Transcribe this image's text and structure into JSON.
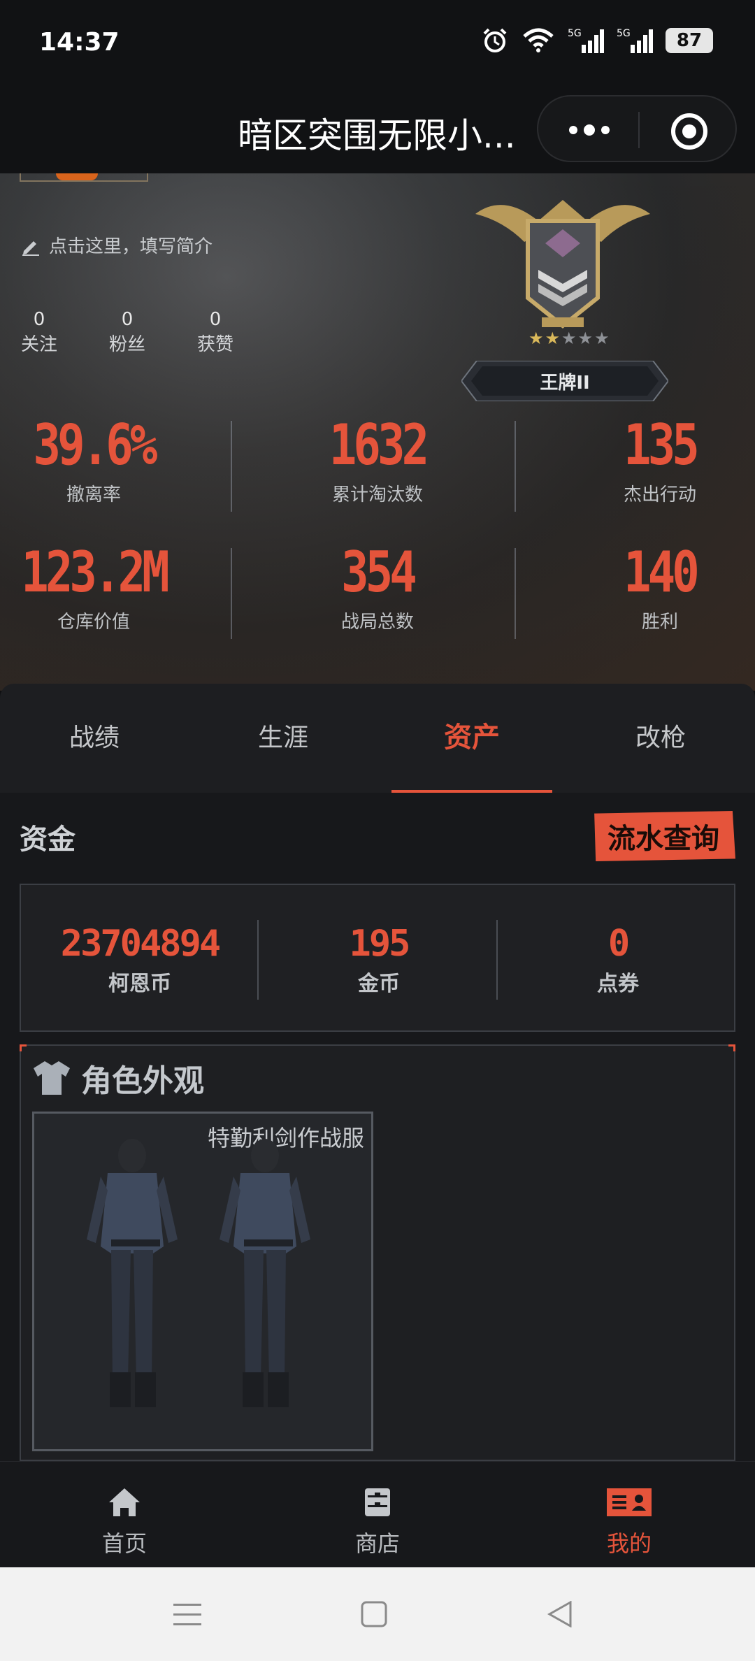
{
  "status": {
    "time": "14:37",
    "battery": "87",
    "network": [
      "5G",
      "5G"
    ]
  },
  "titlebar": {
    "title": "暗区突围无限小..."
  },
  "profile": {
    "bio_prompt": "点击这里，填写简介",
    "counts": [
      {
        "value": "0",
        "label": "关注"
      },
      {
        "value": "0",
        "label": "粉丝"
      },
      {
        "value": "0",
        "label": "获赞"
      }
    ],
    "rank": {
      "name": "王牌II",
      "stars_filled": 2,
      "stars_total": 5
    }
  },
  "stats": [
    {
      "value": "39.6%",
      "label": "撤离率"
    },
    {
      "value": "1632",
      "label": "累计淘汰数"
    },
    {
      "value": "135",
      "label": "杰出行动"
    },
    {
      "value": "123.2M",
      "label": "仓库价值"
    },
    {
      "value": "354",
      "label": "战局总数"
    },
    {
      "value": "140",
      "label": "胜利"
    }
  ],
  "tabs": [
    {
      "label": "战绩"
    },
    {
      "label": "生涯"
    },
    {
      "label": "资产"
    },
    {
      "label": "改枪"
    }
  ],
  "active_tab": "资产",
  "funds": {
    "title": "资金",
    "ledger_button": "流水查询",
    "items": [
      {
        "value": "23704894",
        "label": "柯恩币"
      },
      {
        "value": "195",
        "label": "金币"
      },
      {
        "value": "0",
        "label": "点券"
      }
    ]
  },
  "outfit": {
    "title": "角色外观",
    "card_name": "特勤利剑作战服"
  },
  "bottom_nav": [
    {
      "label": "首页",
      "icon": "home-icon"
    },
    {
      "label": "商店",
      "icon": "shop-icon"
    },
    {
      "label": "我的",
      "icon": "profile-card-icon"
    }
  ],
  "colors": {
    "accent": "#e5543b",
    "bg": "#17181b",
    "text_muted": "#c0c3c6"
  }
}
